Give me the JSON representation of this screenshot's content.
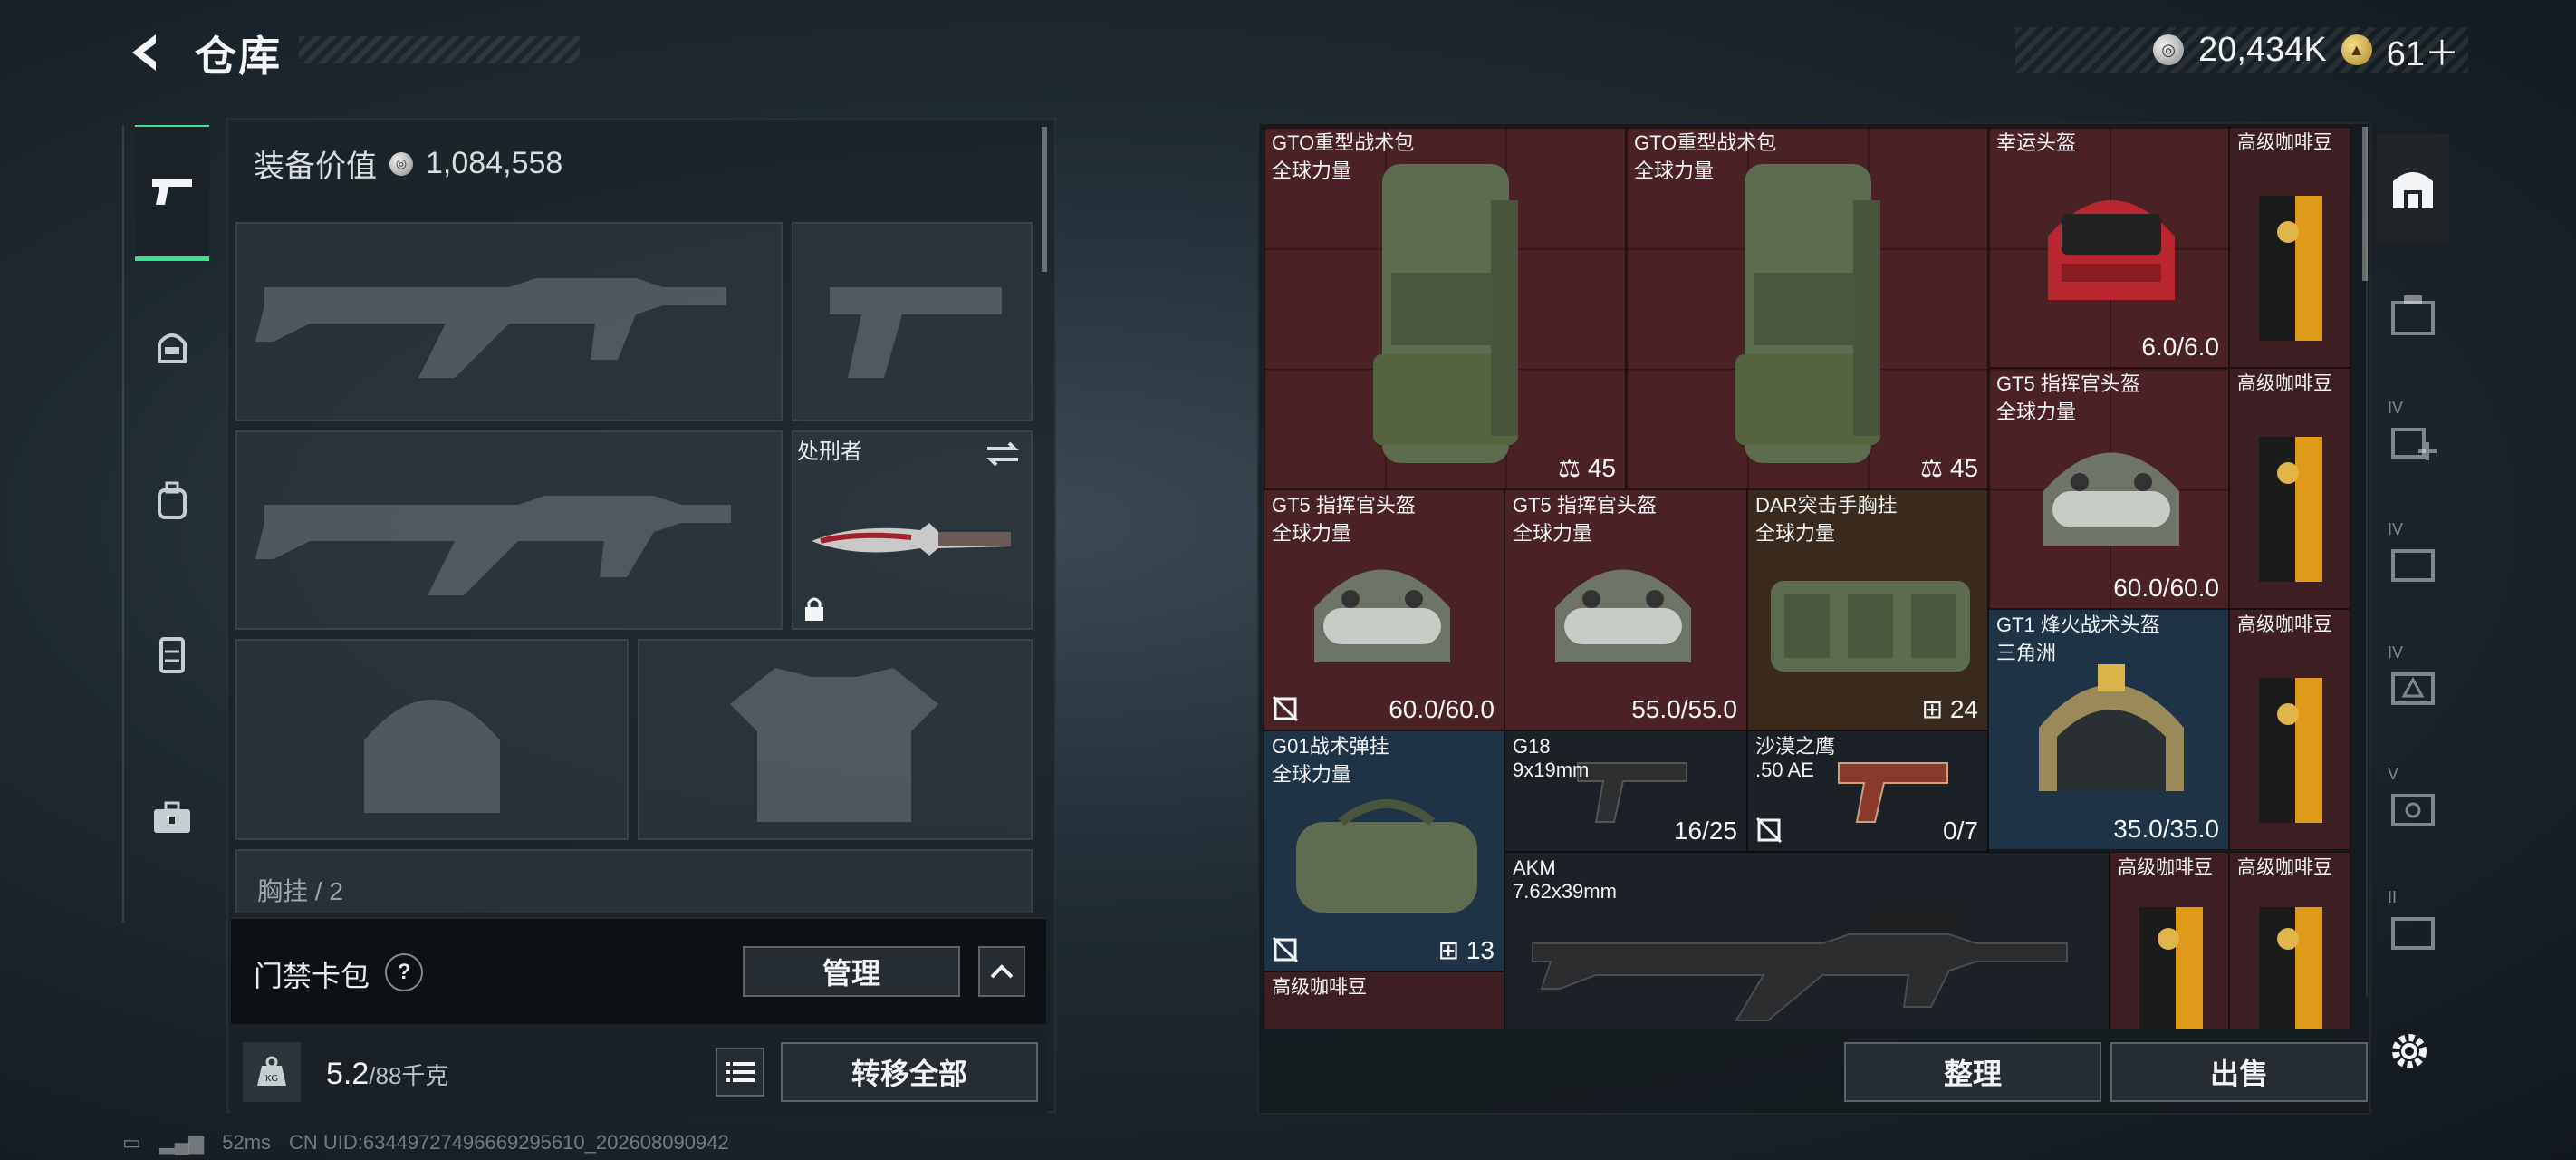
{
  "header": {
    "title": "仓库"
  },
  "currency": {
    "silver": "20,434K",
    "gold": "61＋"
  },
  "loadout": {
    "equip_value_label": "装备价值",
    "equip_value": "1,084,558",
    "knife_label": "处刑者",
    "chest_label": "胸挂",
    "chest_count": "2"
  },
  "keycard": {
    "label": "门禁卡包",
    "help": "?",
    "manage_label": "管理"
  },
  "capacity": {
    "weight": "5.2",
    "max": "/88千克",
    "transfer_all_label": "转移全部"
  },
  "inventory": {
    "items": [
      {
        "name": "GTO重型战术包",
        "sub": "全球力量",
        "value": "45"
      },
      {
        "name": "GTO重型战术包",
        "sub": "全球力量",
        "value": "45"
      },
      {
        "name": "幸运头盔",
        "sub": "",
        "value": "6.0/6.0"
      },
      {
        "name": "高级咖啡豆",
        "sub": "",
        "value": ""
      },
      {
        "name": "GT5 指挥官头盔",
        "sub": "全球力量",
        "value": "60.0/60.0"
      },
      {
        "name": "高级咖啡豆",
        "sub": "",
        "value": ""
      },
      {
        "name": "GT5 指挥官头盔",
        "sub": "全球力量",
        "value": "60.0/60.0"
      },
      {
        "name": "GT5 指挥官头盔",
        "sub": "全球力量",
        "value": "55.0/55.0"
      },
      {
        "name": "DAR突击手胸挂",
        "sub": "全球力量",
        "value": "24"
      },
      {
        "name": "GT1 烽火战术头盔",
        "sub": "三角洲",
        "value": "35.0/35.0"
      },
      {
        "name": "高级咖啡豆",
        "sub": "",
        "value": ""
      },
      {
        "name": "G01战术弹挂",
        "sub": "全球力量",
        "value": "13"
      },
      {
        "name": "G18",
        "sub": "9x19mm",
        "value": "16/25"
      },
      {
        "name": "沙漠之鹰",
        "sub": ".50 AE",
        "value": "0/7"
      },
      {
        "name": "AKM",
        "sub": "7.62x39mm",
        "value": ""
      },
      {
        "name": "高级咖啡豆",
        "sub": "",
        "value": ""
      },
      {
        "name": "高级咖啡豆",
        "sub": "",
        "value": ""
      },
      {
        "name": "高级咖啡豆",
        "sub": "",
        "value": ""
      }
    ]
  },
  "right_tabs": [
    "",
    "",
    "IV",
    "IV",
    "IV",
    "V",
    "II"
  ],
  "actions": {
    "sort_label": "整理",
    "sell_label": "出售"
  },
  "status": {
    "ping": "52ms",
    "uid": "CN UID:6344972749666929561​0_202608090942"
  },
  "colors": {
    "accent_green": "#3ee08c",
    "cell_red": "#4a2226",
    "cell_blue": "#1f3346"
  }
}
